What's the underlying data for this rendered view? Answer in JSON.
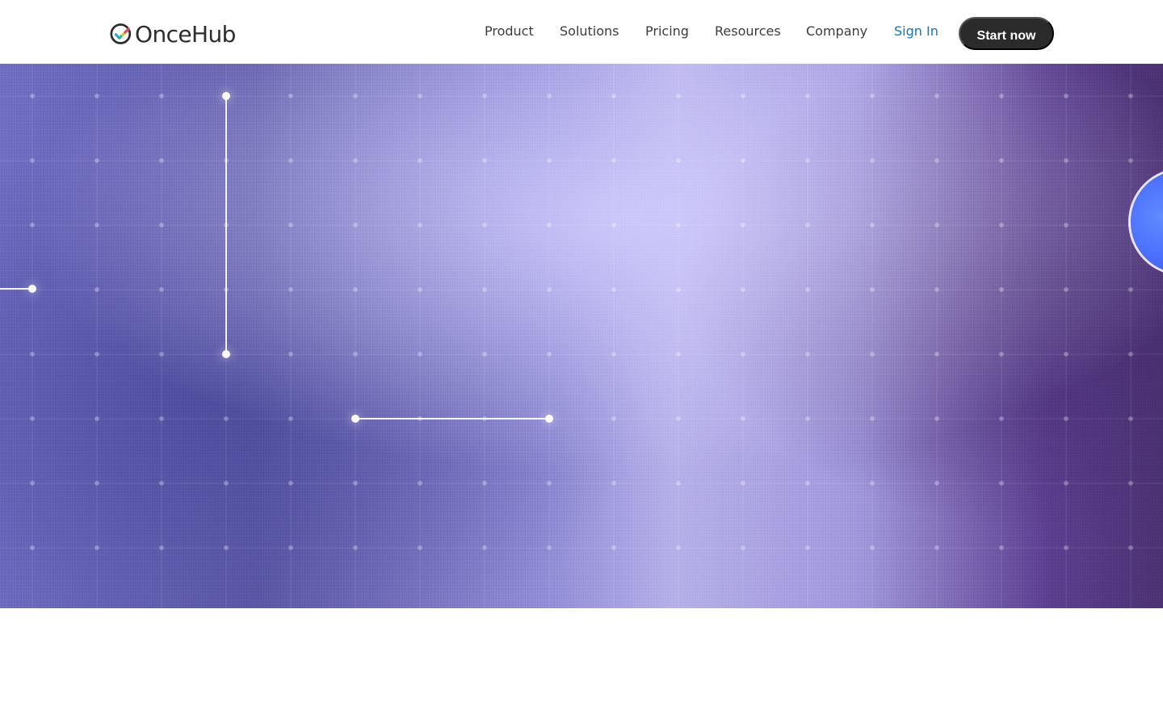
{
  "header": {
    "logo_text": "OnceHub",
    "nav": [
      {
        "label": "Product"
      },
      {
        "label": "Solutions"
      },
      {
        "label": "Pricing"
      },
      {
        "label": "Resources"
      },
      {
        "label": "Company"
      }
    ],
    "sign_in": "Sign In",
    "cta": "Start now"
  },
  "icons": {
    "logo_mark": "oncehub-logo-icon",
    "hero_circle": "circle-icon"
  },
  "colors": {
    "nav_text": "#3c3c3c",
    "sign_in": "#0b7bbd",
    "cta_bg": "#2b2b2b",
    "cta_text": "#ffffff",
    "hero_accent": "#ffffff",
    "hero_circle": "#4b6eff"
  }
}
